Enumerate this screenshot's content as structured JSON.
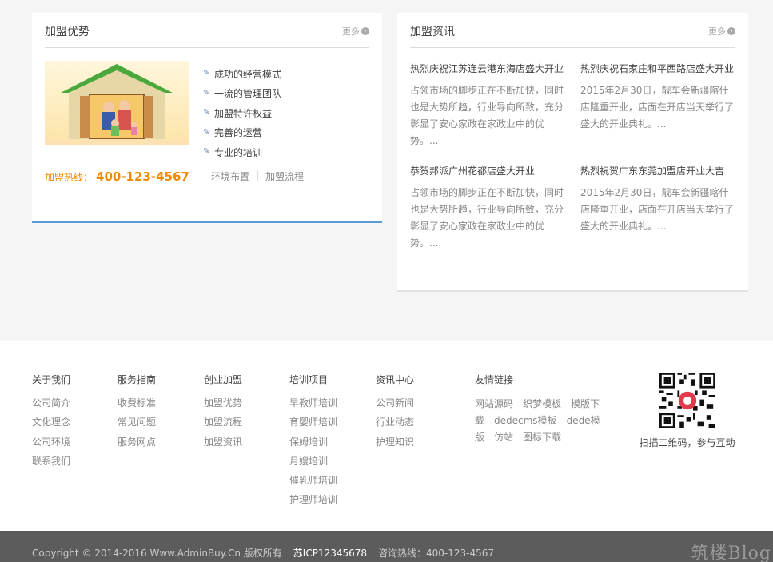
{
  "advantages": {
    "title": "加盟优势",
    "more": "更多",
    "features": [
      "成功的经营模式",
      "一流的管理团队",
      "加盟特许权益",
      "完善的运营",
      "专业的培训"
    ],
    "hotline_label": "加盟热线：",
    "hotline_number": "400-123-4567",
    "link_env": "环境布置",
    "link_sep": "|",
    "link_process": "加盟流程"
  },
  "news": {
    "title": "加盟资讯",
    "more": "更多",
    "items": [
      {
        "title": "热烈庆祝江苏连云港东海店盛大开业",
        "summary": "占领市场的脚步正在不断加快，同时也是大势所趋，行业导向所致，充分彰显了安心家政在家政业中的优势。..."
      },
      {
        "title": "热烈庆祝石家庄和平西路店盛大开业",
        "summary": "2015年2月30日，靓车会新疆喀什店隆重开业，店面在开店当天举行了盛大的开业典礼。..."
      },
      {
        "title": "恭贺邦派广州花都店盛大开业",
        "summary": "占领市场的脚步正在不断加快，同时也是大势所趋，行业导向所致，充分彰显了安心家政在家政业中的优势。..."
      },
      {
        "title": "热烈祝贺广东东莞加盟店开业大吉",
        "summary": "2015年2月30日，靓车会新疆喀什店隆重开业，店面在开店当天举行了盛大的开业典礼。..."
      }
    ]
  },
  "footer": {
    "columns": [
      {
        "title": "关于我们",
        "links": [
          "公司简介",
          "文化理念",
          "公司环境",
          "联系我们"
        ]
      },
      {
        "title": "服务指南",
        "links": [
          "收费标准",
          "常见问题",
          "服务网点"
        ]
      },
      {
        "title": "创业加盟",
        "links": [
          "加盟优势",
          "加盟流程",
          "加盟资讯"
        ]
      },
      {
        "title": "培训项目",
        "links": [
          "早教师培训",
          "育婴师培训",
          "保姆培训",
          "月嫂培训",
          "催乳师培训",
          "护理师培训"
        ]
      },
      {
        "title": "资讯中心",
        "links": [
          "公司新闻",
          "行业动态",
          "护理知识"
        ]
      }
    ],
    "friend_title": "友情链接",
    "friend_links": [
      "网站源码",
      "织梦模板",
      "模版下载",
      "dedecms模板",
      "dede模版",
      "仿站",
      "图标下载"
    ],
    "qr_caption": "扫描二维码，参与互动"
  },
  "bottom": {
    "copyright": "Copyright © 2014-2016 Www.AdminBuy.Cn 版权所有",
    "icp": "苏ICP12345678",
    "consult": "咨询热线：400-123-4567",
    "watermark": "筑楼Blog"
  },
  "colors": {
    "accent": "#f08a00",
    "link_border": "#5b9bd5",
    "footer_bar": "#5c5c5c"
  }
}
